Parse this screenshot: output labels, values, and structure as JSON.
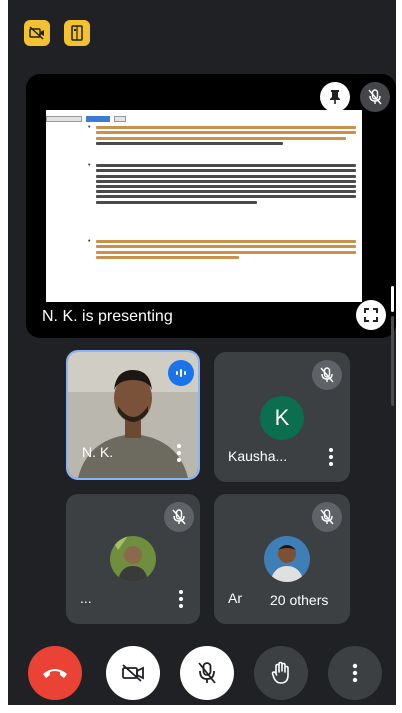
{
  "top_icons": [
    {
      "icon": "camera-off-icon",
      "color": "#f2c230"
    },
    {
      "icon": "flip-camera-icon",
      "color": "#f2c230"
    }
  ],
  "presentation": {
    "label": "N. K. is presenting",
    "pin_icon": "pin-icon",
    "mute_icon": "mic-off-icon",
    "fullscreen_icon": "fullscreen-icon"
  },
  "participants": [
    {
      "name": "N. K.",
      "state": "speaking",
      "has_video": true
    },
    {
      "name": "Kausha...",
      "avatar_letter": "K",
      "avatar_color": "#0b6e4f",
      "muted": true
    },
    {
      "name": "...",
      "muted": true
    },
    {
      "name": "Ar",
      "muted": true
    }
  ],
  "others_chip": "20 others",
  "controls": [
    {
      "icon": "end-call-icon",
      "color": "#ea4335"
    },
    {
      "icon": "camera-off-icon",
      "color": "#ffffff"
    },
    {
      "icon": "mic-off-icon",
      "color": "#ffffff"
    },
    {
      "icon": "raise-hand-icon",
      "color": "#3c4043"
    },
    {
      "icon": "more-options-icon",
      "color": "#3c4043"
    }
  ]
}
